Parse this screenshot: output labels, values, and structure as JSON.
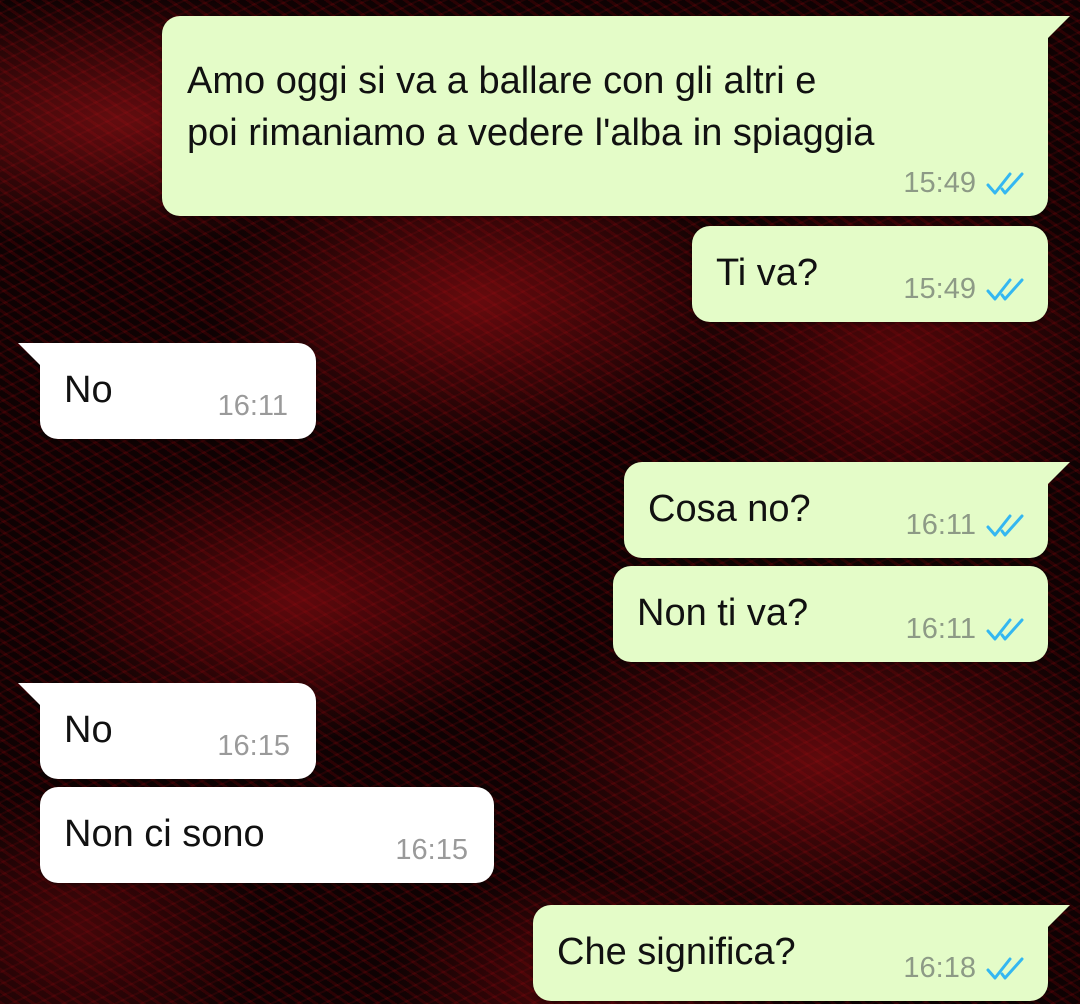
{
  "chat": {
    "accent_tick_color": "#34b7f1",
    "outgoing_bubble_color": "#e4fcc8",
    "incoming_bubble_color": "#ffffff",
    "messages": [
      {
        "direction": "outgoing",
        "lines": [
          "Amo oggi si va a ballare con gli altri e",
          "poi rimaniamo a vedere l'alba in spiaggia"
        ],
        "time": "15:49",
        "status": "read",
        "status_icon": "double-check-icon"
      },
      {
        "direction": "outgoing",
        "lines": [
          "Ti va?"
        ],
        "time": "15:49",
        "status": "read",
        "status_icon": "double-check-icon"
      },
      {
        "direction": "incoming",
        "lines": [
          "No"
        ],
        "time": "16:11"
      },
      {
        "direction": "outgoing",
        "lines": [
          "Cosa no?"
        ],
        "time": "16:11",
        "status": "read",
        "status_icon": "double-check-icon"
      },
      {
        "direction": "outgoing",
        "lines": [
          "Non ti va?"
        ],
        "time": "16:11",
        "status": "read",
        "status_icon": "double-check-icon"
      },
      {
        "direction": "incoming",
        "lines": [
          "No"
        ],
        "time": "16:15"
      },
      {
        "direction": "incoming",
        "lines": [
          "Non ci sono"
        ],
        "time": "16:15"
      },
      {
        "direction": "outgoing",
        "lines": [
          "Che significa?"
        ],
        "time": "16:18",
        "status": "read",
        "status_icon": "double-check-icon"
      }
    ]
  }
}
